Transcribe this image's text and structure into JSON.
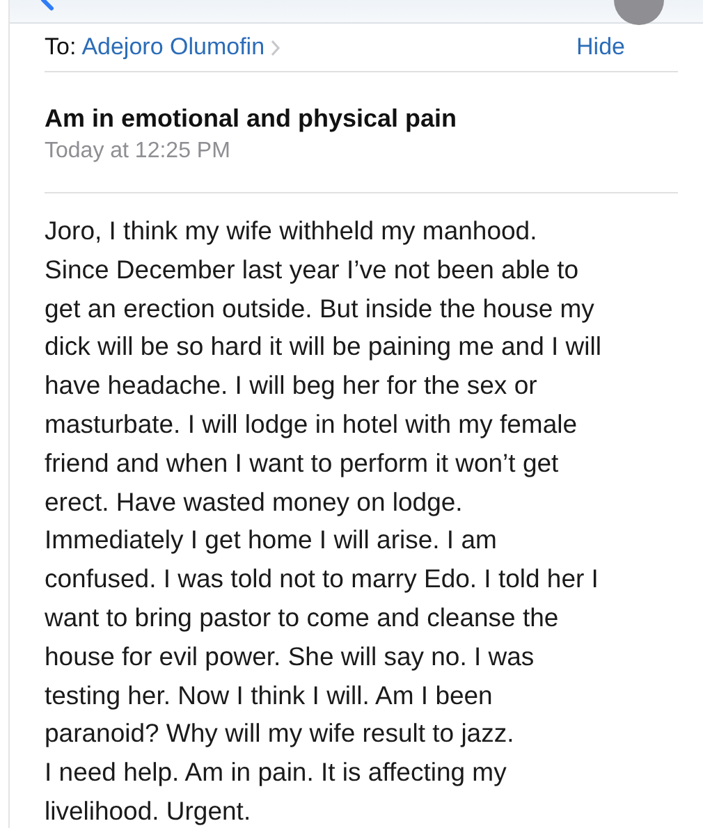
{
  "recipient": {
    "label": "To:",
    "name": "Adejoro Olumofin",
    "action": "Hide"
  },
  "subject": "Am in emotional and physical pain",
  "date": "Today at 12:25 PM",
  "body_lines": [
    "Joro, I think my wife withheld my manhood.",
    "Since December last year I’ve not been able to",
    "get an erection outside. But inside the house my",
    "dick will be so hard it will be paining me and I will",
    "have headache. I will beg her for the sex or",
    "masturbate. I will lodge in hotel with my female",
    "friend and when I want to perform it won’t get",
    "erect. Have wasted money on lodge.",
    "Immediately I get home I will arise. I am",
    "confused. I was told not to marry Edo. I told her I",
    "want to bring pastor to come and cleanse the",
    "house for evil power. She will say no. I was",
    "testing her. Now I think I will. Am I been",
    "paranoid? Why will my wife result to jazz.",
    "I need help. Am in pain. It is affecting my",
    "livelihood. Urgent."
  ]
}
